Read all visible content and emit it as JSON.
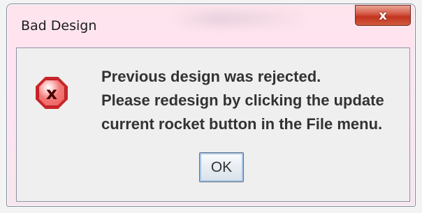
{
  "dialog": {
    "title": "Bad Design",
    "close_label": "x",
    "close_icon": "close-icon",
    "error_icon": "error-icon",
    "error_symbol": "x",
    "message_lines": [
      "Previous design was rejected.",
      "Please redesign by clicking the update",
      "current rocket button in the File menu."
    ],
    "ok_label": "OK"
  },
  "colors": {
    "close_button_red": "#c3341f",
    "error_red": "#c8262a",
    "ok_focus_blue": "#a8c6e5"
  }
}
